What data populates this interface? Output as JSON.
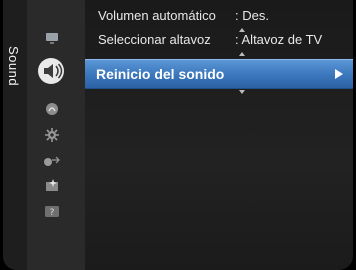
{
  "menu": {
    "category": "Sound",
    "icons": [
      "picture-icon",
      "sound-icon",
      "channel-icon",
      "setup-icon",
      "input-icon",
      "application-icon",
      "support-icon"
    ],
    "items": [
      {
        "label": "Volumen automático",
        "value": ": Des."
      },
      {
        "label": "Seleccionar altavoz",
        "value": ": Altavoz de TV"
      }
    ],
    "selected": {
      "label": "Reinicio del sonido"
    }
  },
  "colors": {
    "highlight": "#3d79be",
    "text": "#e8e8e8",
    "background": "#1a1a1a"
  }
}
